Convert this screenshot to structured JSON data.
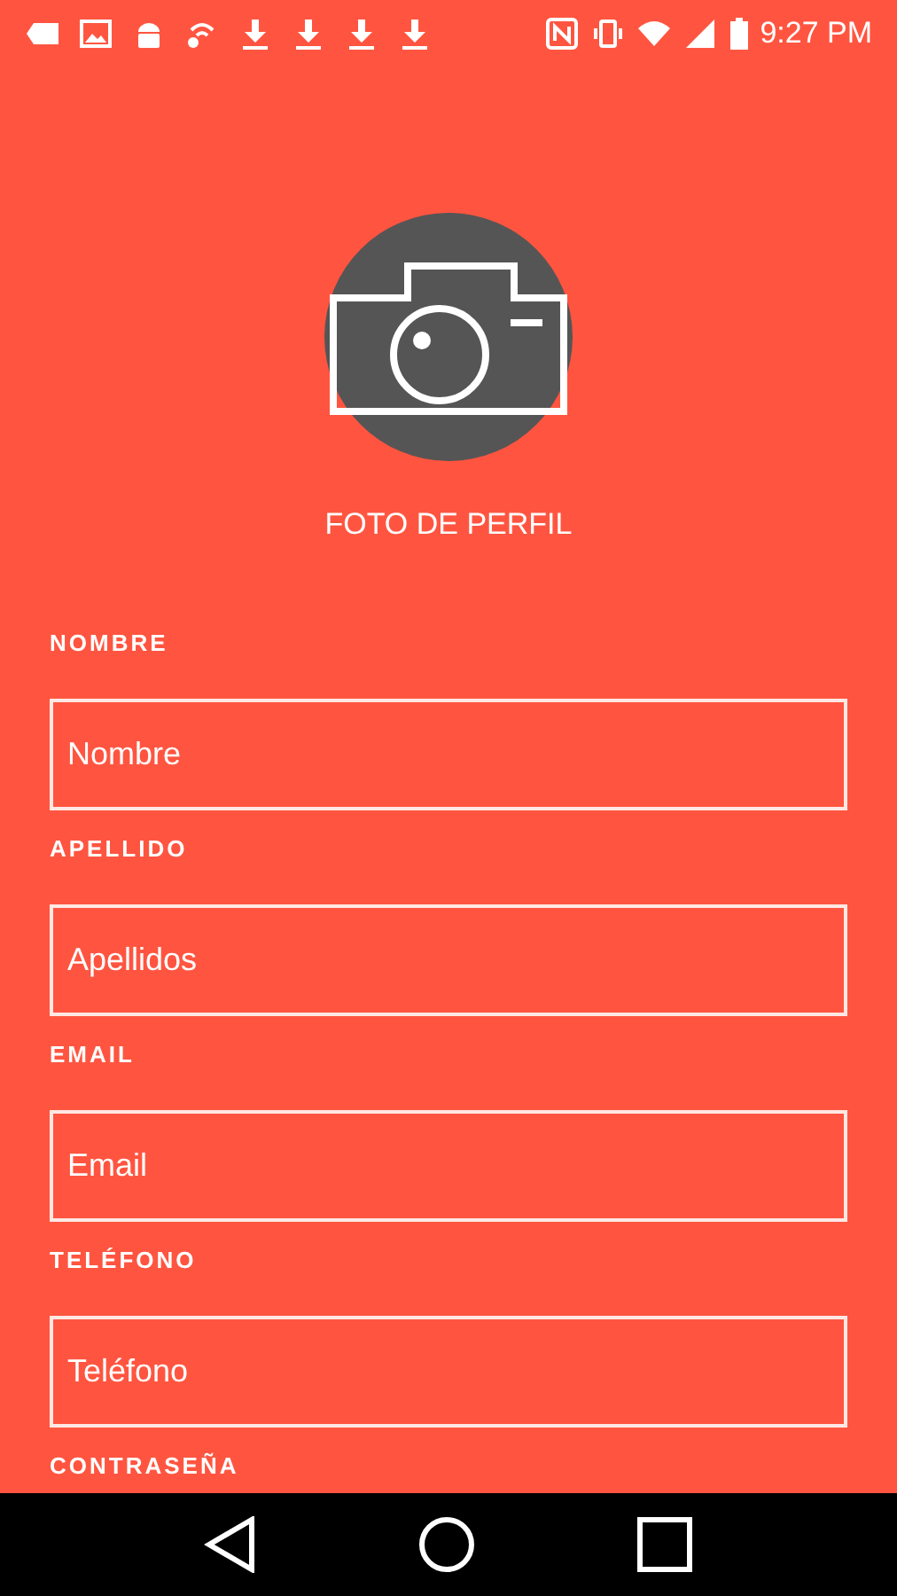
{
  "status_bar": {
    "time": "9:27 PM"
  },
  "profile_photo": {
    "label": "FOTO DE PERFIL"
  },
  "fields": [
    {
      "label": "NOMBRE",
      "placeholder": "Nombre"
    },
    {
      "label": "APELLIDO",
      "placeholder": "Apellidos"
    },
    {
      "label": "EMAIL",
      "placeholder": "Email"
    },
    {
      "label": "TELÉFONO",
      "placeholder": "Teléfono"
    },
    {
      "label": "CONTRASEÑA"
    }
  ]
}
